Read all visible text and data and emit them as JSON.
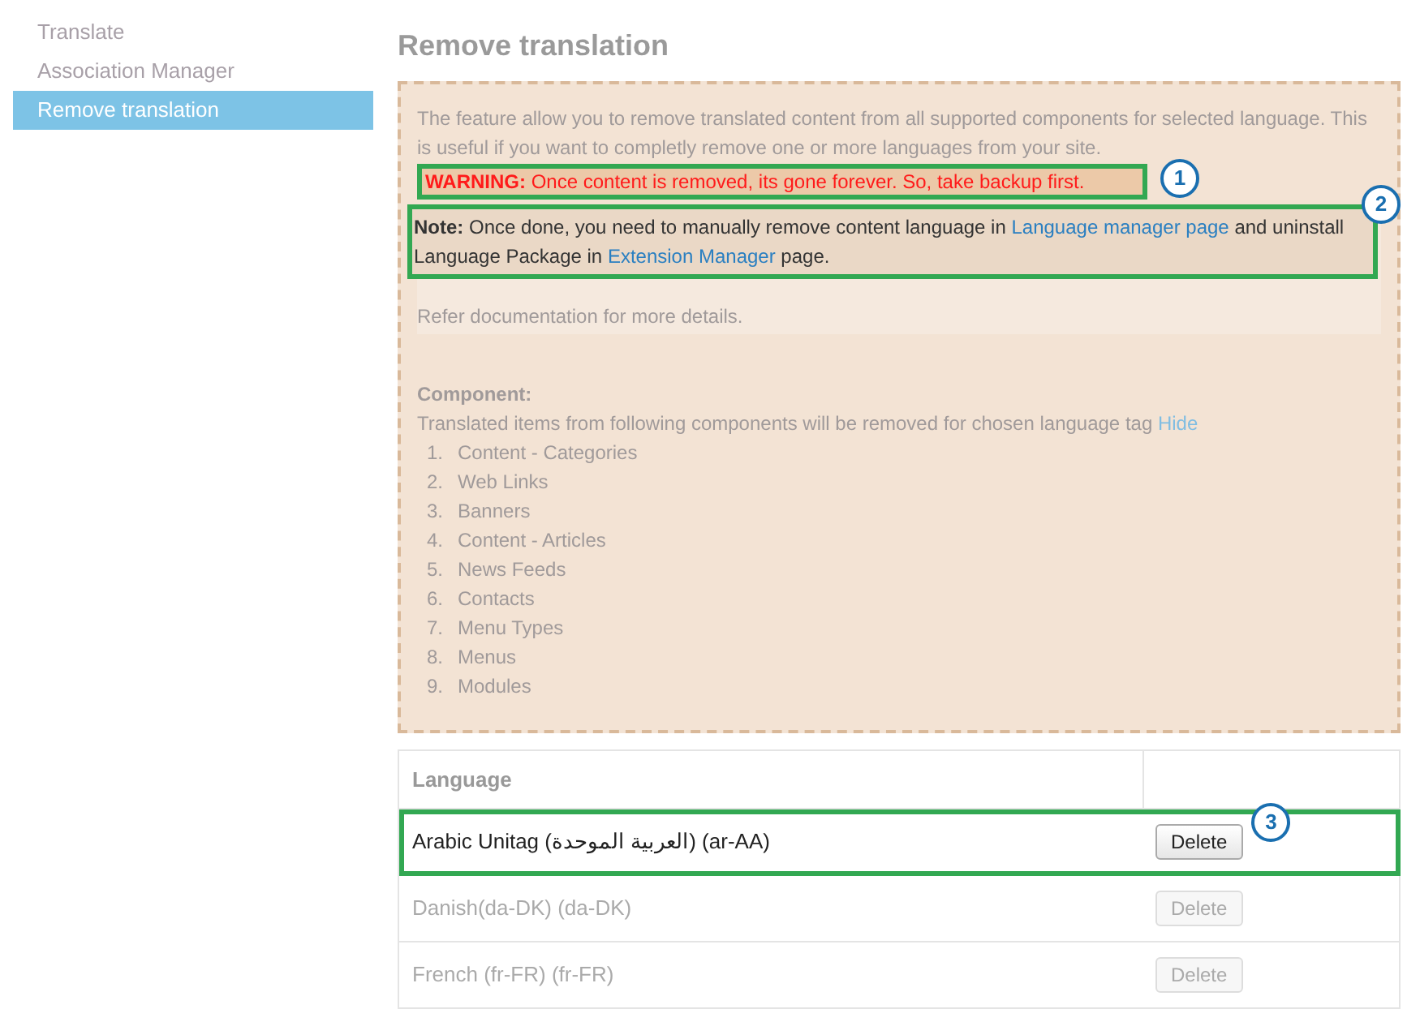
{
  "sidebar": {
    "items": [
      {
        "label": "Translate",
        "selected": false
      },
      {
        "label": "Association Manager",
        "selected": false
      },
      {
        "label": "Remove translation",
        "selected": true
      }
    ]
  },
  "title": "Remove translation",
  "intro": "The feature allow you to remove translated content from all supported components for selected language. This is useful if you want to completly remove one or more languages from your site.",
  "warning": {
    "text": "**WARNING:** Once content is removed, its gone forever. So, take backup first.",
    "callout": "1"
  },
  "note": {
    "segments": [
      {
        "kind": "text",
        "text": "**Note:** Once done, you need to manually remove content language in "
      },
      {
        "kind": "link",
        "text": "Language manager page"
      },
      {
        "kind": "text",
        "text": " and uninstall Language Package in "
      },
      {
        "kind": "link",
        "text": "Extension Manager"
      },
      {
        "kind": "text",
        "text": " page."
      }
    ],
    "callout": "2"
  },
  "refer": "Refer documentation for more details.",
  "component": {
    "heading": "Component:",
    "description": "Translated items from following components will be removed for chosen language tag",
    "toggle": "Hide",
    "items": [
      {
        "number": "1.",
        "label": "Content - Categories"
      },
      {
        "number": "2.",
        "label": "Web Links"
      },
      {
        "number": "3.",
        "label": "Banners"
      },
      {
        "number": "4.",
        "label": "Content - Articles"
      },
      {
        "number": "5.",
        "label": "News Feeds"
      },
      {
        "number": "6.",
        "label": "Contacts"
      },
      {
        "number": "7.",
        "label": "Menu Types"
      },
      {
        "number": "8.",
        "label": "Menus"
      },
      {
        "number": "9.",
        "label": "Modules"
      }
    ]
  },
  "table": {
    "columns": [
      "Language"
    ],
    "rows": [
      {
        "language": "Arabic Unitag (العربية الموحدة) (ar-AA)",
        "action": "Delete",
        "disabled": false,
        "callout": "3"
      },
      {
        "language": "Danish(da-DK) (da-DK)",
        "action": "Delete",
        "disabled": true
      },
      {
        "language": "French (fr-FR) (fr-FR)",
        "action": "Delete",
        "disabled": true
      }
    ]
  }
}
